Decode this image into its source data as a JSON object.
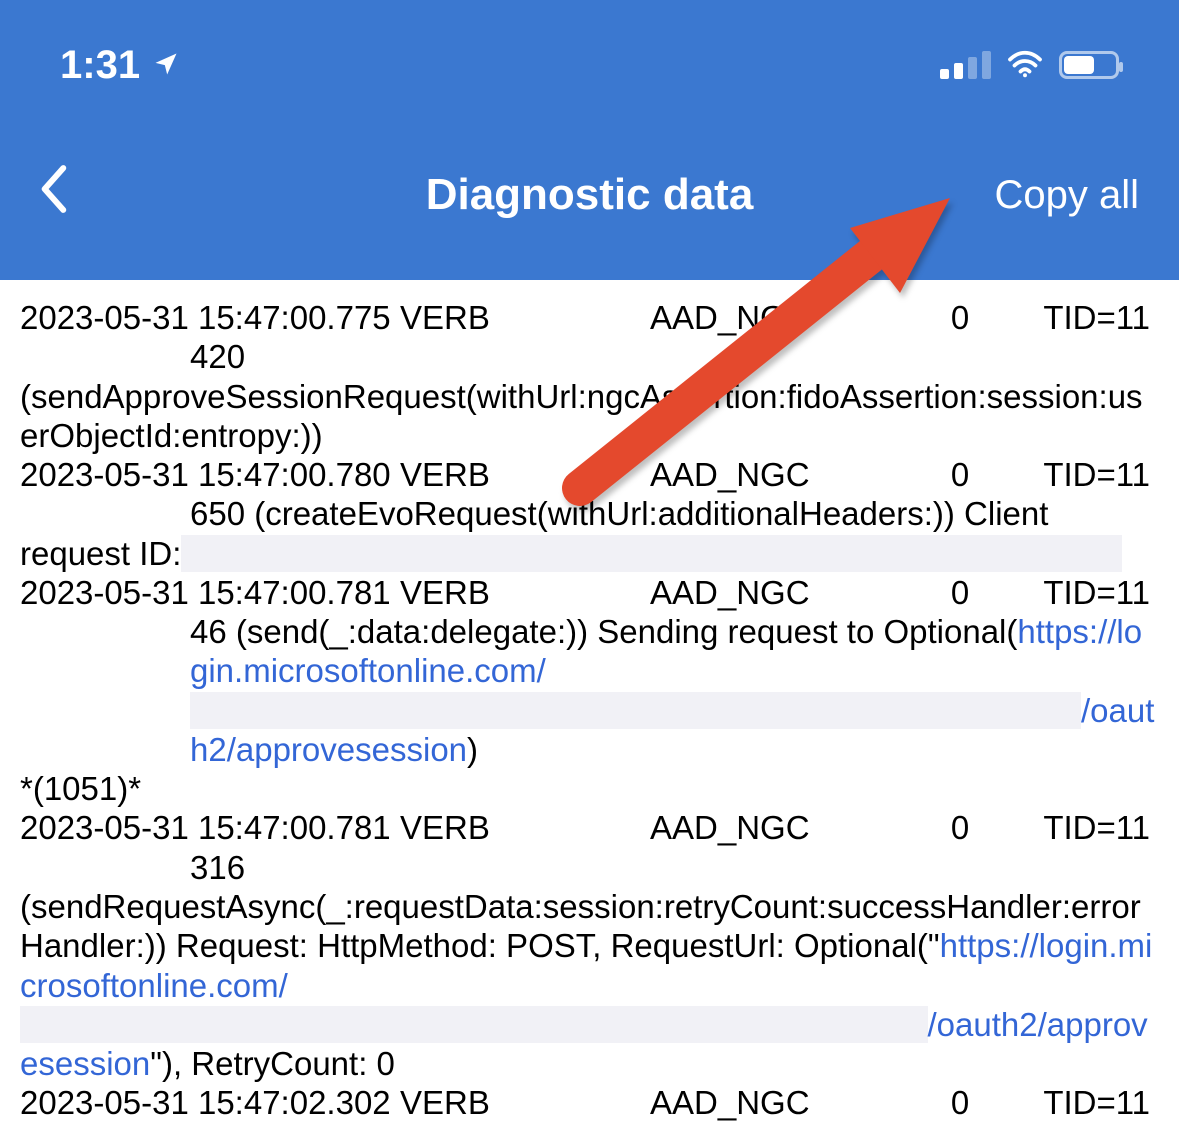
{
  "status_bar": {
    "time": "1:31",
    "has_location": true,
    "signal_bars_total": 4,
    "signal_bars_on": 2,
    "wifi": true,
    "battery_percent": 60
  },
  "nav": {
    "back_glyph": "‹",
    "title": "Diagnostic data",
    "copy_all": "Copy all"
  },
  "log": [
    {
      "ts": "2023-05-31 15:47:00.775",
      "level": "VERB",
      "tag": "AAD_NGC",
      "code": "0",
      "tid": "TID=11",
      "msg_indent": "420",
      "msg_full": "(sendApproveSessionRequest(withUrl:ngcAssertion:fidoAssertion:session:userObjectId:entropy:))"
    },
    {
      "ts": "2023-05-31 15:47:00.780",
      "level": "VERB",
      "tag": "AAD_NGC",
      "code": "0",
      "tid": "TID=11",
      "msg_indent_pre": "650 (createEvoRequest(withUrl:additionalHeaders:)) Client",
      "msg_full_pre": "request ID:",
      "redacted": " "
    },
    {
      "ts": "2023-05-31 15:47:00.781",
      "level": "VERB",
      "tag": "AAD_NGC",
      "code": "0",
      "tid": "TID=11",
      "msg_indent_pre": "46 (send(_:data:delegate:)) Sending request to Optional(",
      "link1": "https://login.microsoftonline.com/",
      "redacted_mid": " ",
      "link2": "/oauth2/approvesession",
      "close_paren": ")",
      "footer": "*(1051)*"
    },
    {
      "ts": "2023-05-31 15:47:00.781",
      "level": "VERB",
      "tag": "AAD_NGC",
      "code": "0",
      "tid": "TID=11",
      "msg_indent": "316",
      "msg_full_pre": "(sendRequestAsync(_:requestData:session:retryCount:successHandler:errorHandler:)) Request: HttpMethod: POST, RequestUrl: Optional(\"",
      "link1": "https://login.microsoftonline.com/",
      "redacted_mid": " ",
      "link2": "/oauth2/approvesession",
      "msg_full_post": "\"), RetryCount: 0"
    },
    {
      "ts": "2023-05-31 15:47:02.302",
      "level": "VERB",
      "tag": "AAD_NGC",
      "code": "0",
      "tid": "TID=11"
    }
  ]
}
